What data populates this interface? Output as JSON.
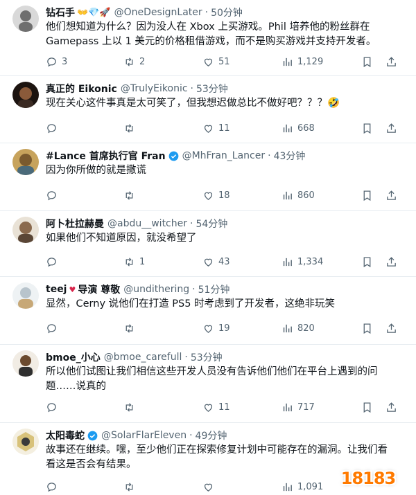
{
  "tweets": [
    {
      "name": "钻石手",
      "emoji": "👐💎🚀",
      "handle": "@OneDesignLater",
      "time": "50分钟",
      "text_lines": [
        "他们想知道为什么？因为没人在 Xbox 上买游戏。Phil 培养他的粉丝群在",
        "Gamepass 上以 1 美元的价格租借游戏，而不是购买游戏并支持开发者。"
      ],
      "replies": "3",
      "retweets": "2",
      "likes": "51",
      "views": "1,129",
      "avatar_color": "#6f6f6f"
    },
    {
      "name": "真正的 Eikonic",
      "handle": "@TrulyEikonic",
      "time": "53分钟",
      "text_lines": [
        "现在关心这件事真是太可笑了，但我想迟做总比不做好吧？？？🤣"
      ],
      "replies": "",
      "retweets": "",
      "likes": "11",
      "views": "668",
      "avatar_color": "#3a2a22"
    },
    {
      "name": "#Lance 首席执行官 Fran",
      "handle": "@MhFran_Lancer",
      "time": "43分钟",
      "verified": true,
      "text_lines": [
        "因为你所做的就是撒谎"
      ],
      "replies": "",
      "retweets": "",
      "likes": "18",
      "views": "860",
      "avatar_color": "#a07a3c"
    },
    {
      "name": "阿卜杜拉赫曼",
      "handle": "@abdu__witcher",
      "time": "54分钟",
      "text_lines": [
        "如果他们不知道原因，就没希望了"
      ],
      "replies": "",
      "retweets": "1",
      "likes": "43",
      "views": "1,334",
      "avatar_color": "#5a4636"
    },
    {
      "name": "teej",
      "badge": "♥",
      "name2": "导演 尊敬",
      "handle": "@undithering",
      "time": "51分钟",
      "text_lines": [
        "显然，Cerny 说他们在打造 PS5 时考虑到了开发者，这绝非玩笑"
      ],
      "replies": "",
      "retweets": "",
      "likes": "19",
      "views": "820",
      "avatar_color": "#b8c4cc"
    },
    {
      "name": "bmoe_小心",
      "handle": "@bmoe_carefull",
      "time": "53分钟",
      "text_lines": [
        "所以他们试图让我们相信这些开发人员没有告诉他们他们在平台上遇到的问",
        "题……说真的"
      ],
      "replies": "",
      "retweets": "",
      "likes": "11",
      "views": "717",
      "avatar_color": "#6b4a2e"
    },
    {
      "name": "太阳毒蛇",
      "handle": "@SolarFlarEleven",
      "time": "49分钟",
      "verified": true,
      "text_lines": [
        "故事还在继续。嘿，至少他们正在探索修复计划中可能存在的漏洞。让我们看",
        "看这是否会有结果。"
      ],
      "replies": "",
      "retweets": "",
      "likes": "",
      "views": "1,091",
      "avatar_color": "#d8c27a"
    }
  ],
  "watermark": "18183"
}
